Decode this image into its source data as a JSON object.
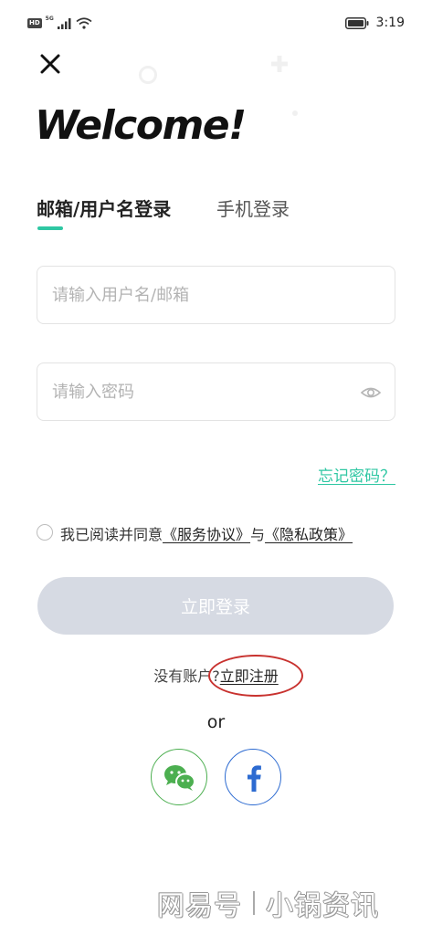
{
  "status_bar": {
    "hd_badge": "HD",
    "network": "5G",
    "time": "3:19"
  },
  "header": {
    "title": "Welcome!"
  },
  "tabs": [
    {
      "label": "邮箱/用户名登录",
      "active": true
    },
    {
      "label": "手机登录",
      "active": false
    }
  ],
  "form": {
    "username_placeholder": "请输入用户名/邮箱",
    "password_placeholder": "请输入密码",
    "forgot_password": "忘记密码？"
  },
  "agreement": {
    "prefix": "我已阅读并同意",
    "terms": "《服务协议》",
    "conjunction": "与",
    "privacy": "《隐私政策》",
    "checked": false
  },
  "login_button": "立即登录",
  "register": {
    "prompt": "没有账户?",
    "link": "立即注册"
  },
  "divider": "or",
  "social": [
    {
      "name": "wechat",
      "icon": "wechat-icon",
      "color": "#4caf50"
    },
    {
      "name": "facebook",
      "icon": "facebook-icon",
      "color": "#2d6bd1"
    }
  ],
  "watermark": {
    "source": "网易号",
    "author": "小锅资讯"
  },
  "colors": {
    "accent": "#2fc7a3",
    "button_disabled": "#d6dae3",
    "annotation": "#c8322f"
  }
}
